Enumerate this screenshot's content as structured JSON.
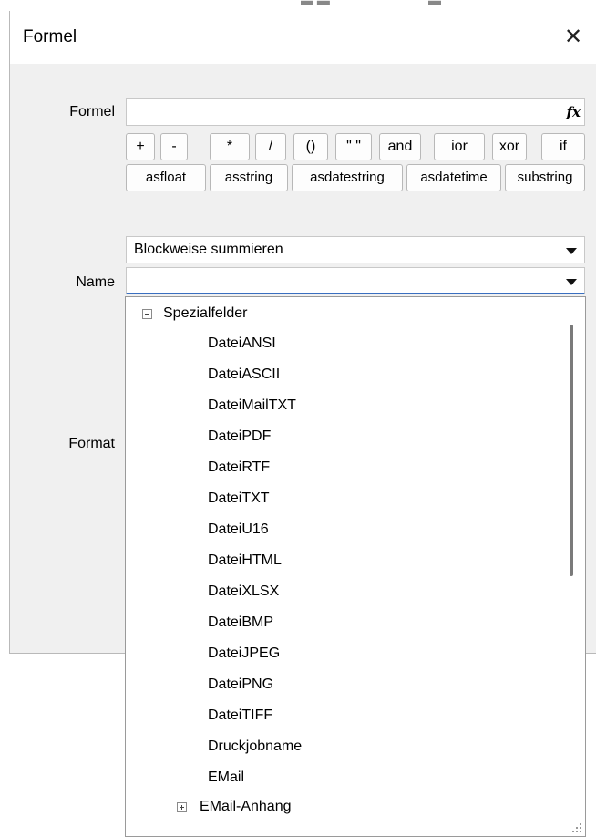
{
  "dialog": {
    "title": "Formel",
    "close_glyph": "✕"
  },
  "formula": {
    "label": "Formel",
    "value": "",
    "fx_icon": "fx-icon",
    "fx_text": "fx"
  },
  "operators_row1": [
    "+",
    "-",
    "*",
    "/",
    "()",
    "\" \"",
    "and",
    "ior",
    "xor",
    "if"
  ],
  "operators_row2": [
    "asfloat",
    "asstring",
    "asdatestring",
    "asdatetime",
    "substring"
  ],
  "combo1": {
    "value": "Blockweise summieren"
  },
  "name": {
    "label": "Name",
    "value": ""
  },
  "format": {
    "label": "Format"
  },
  "tree": {
    "root_label": "Spezialfelder",
    "items": [
      "DateiANSI",
      "DateiASCII",
      "DateiMailTXT",
      "DateiPDF",
      "DateiRTF",
      "DateiTXT",
      "DateiU16",
      "DateiHTML",
      "DateiXLSX",
      "DateiBMP",
      "DateiJPEG",
      "DateiPNG",
      "DateiTIFF",
      "Druckjobname",
      "EMail"
    ],
    "collapsed_label": "EMail-Anhang"
  }
}
